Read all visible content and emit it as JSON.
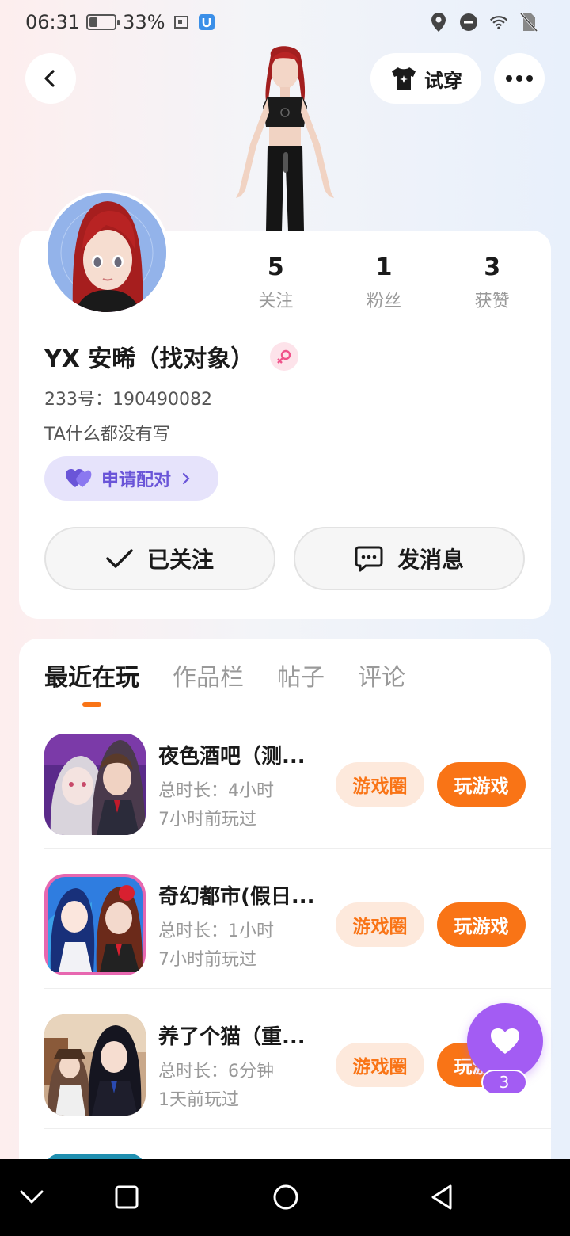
{
  "status_bar": {
    "time": "06:31",
    "battery_percent": "33%",
    "battery_level": 0.33
  },
  "header": {
    "tryon_label": "试穿"
  },
  "profile": {
    "stats": [
      {
        "value": "5",
        "label": "关注"
      },
      {
        "value": "1",
        "label": "粉丝"
      },
      {
        "value": "3",
        "label": "获赞"
      }
    ],
    "name": "YX 安晞（找对象）",
    "uid": "233号：190490082",
    "bio": "TA什么都没有写",
    "pair_label": "申请配对",
    "follow_label": "已关注",
    "message_label": "发消息"
  },
  "tabs": [
    {
      "label": "最近在玩",
      "active": true
    },
    {
      "label": "作品栏",
      "active": false
    },
    {
      "label": "帖子",
      "active": false
    },
    {
      "label": "评论",
      "active": false
    }
  ],
  "games": [
    {
      "title": "夜色酒吧（测...",
      "duration": "总时长：4小时",
      "last_played": "7小时前玩过",
      "circle_label": "游戏圈",
      "play_label": "玩游戏"
    },
    {
      "title": "奇幻都市(假日...",
      "duration": "总时长：1小时",
      "last_played": "7小时前玩过",
      "circle_label": "游戏圈",
      "play_label": "玩游戏"
    },
    {
      "title": "养了个猫（重...",
      "duration": "总时长：6分钟",
      "last_played": "1天前玩过",
      "circle_label": "游戏圈",
      "play_label": "玩游戏"
    }
  ],
  "float_like": {
    "count": "3"
  },
  "colors": {
    "accent_orange": "#f97416",
    "pair_purple": "#6a55d8",
    "like_purple": "#a35cf3"
  }
}
